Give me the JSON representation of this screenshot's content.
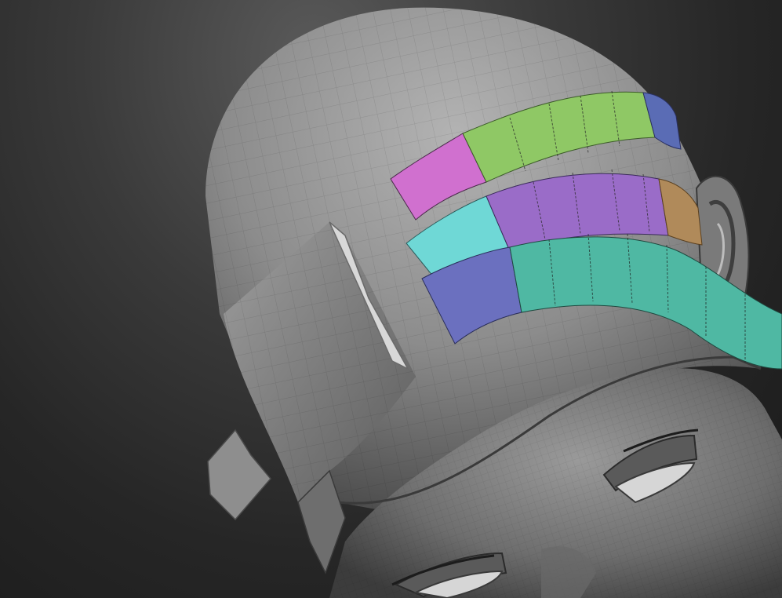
{
  "viewport": {
    "background_top": "#5a5a5a",
    "background_bottom": "#1a1a1a"
  },
  "mesh": {
    "clay_light": "#a9a9a9",
    "clay_mid": "#8a8a8a",
    "clay_dark": "#4a4a4a",
    "wire": "#6f6f6f"
  },
  "polygroups": [
    {
      "name": "strand-top-a",
      "color": "#d070cf"
    },
    {
      "name": "strand-top-b",
      "color": "#8fc865"
    },
    {
      "name": "strand-top-c",
      "color": "#5a6cb5"
    },
    {
      "name": "strand-mid-a",
      "color": "#6fd8d6"
    },
    {
      "name": "strand-mid-b",
      "color": "#9a6cc8"
    },
    {
      "name": "strand-mid-c",
      "color": "#b08a5a"
    },
    {
      "name": "strand-low-a",
      "color": "#6b70bf"
    },
    {
      "name": "strand-low-b",
      "color": "#4fb8a3"
    }
  ]
}
